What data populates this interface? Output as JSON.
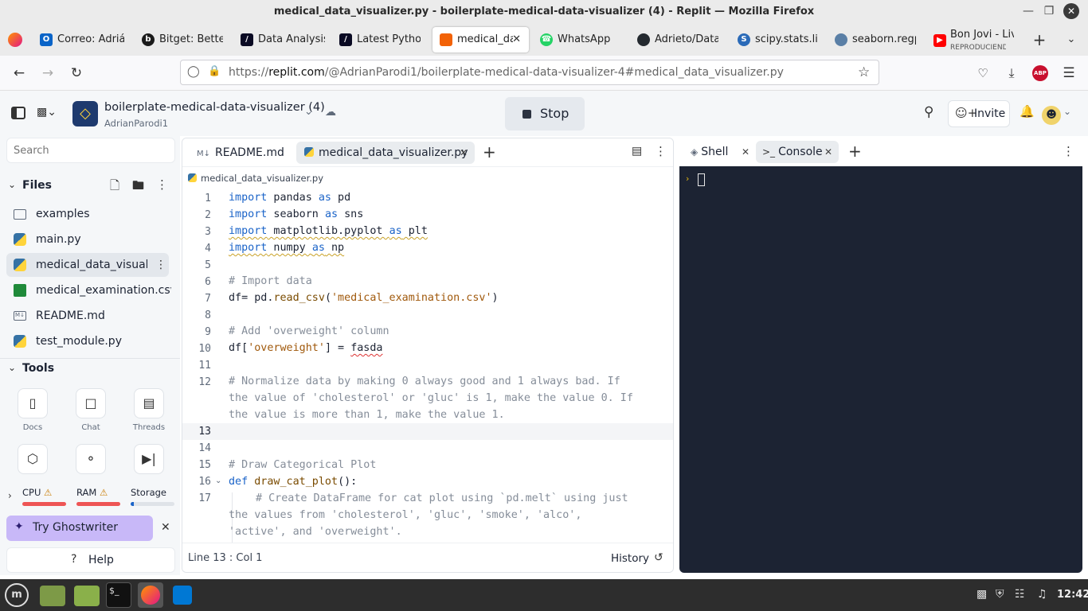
{
  "window": {
    "title": "medical_data_visualizer.py - boilerplate-medical-data-visualizer (4) - Replit — Mozilla Firefox"
  },
  "browser_tabs": [
    {
      "label": "Correo: Adriá",
      "icon": "outlook-icon"
    },
    {
      "label": "Bitget: Better",
      "icon": "bitget-icon"
    },
    {
      "label": "Data Analysis",
      "icon": "fcc-icon"
    },
    {
      "label": "Latest Python",
      "icon": "fcc-icon"
    },
    {
      "label": "medical_da",
      "icon": "replit-icon",
      "active": true
    },
    {
      "label": "WhatsApp",
      "icon": "whatsapp-icon"
    },
    {
      "label": "Adrieto/Data",
      "icon": "github-icon"
    },
    {
      "label": "scipy.stats.lin",
      "icon": "scipy-icon"
    },
    {
      "label": "seaborn.regp",
      "icon": "seaborn-icon"
    },
    {
      "label": "Bon Jovi - Liv",
      "sub": "REPRODUCIENDO",
      "icon": "youtube-icon"
    }
  ],
  "url": {
    "prefix": "https://",
    "domain": "replit.com",
    "path": "/@AdrianParodi1/boilerplate-medical-data-visualizer-4#medical_data_visualizer.py"
  },
  "ext": {
    "abp": "ABP"
  },
  "repl": {
    "name": "boilerplate-medical-data-visualizer (4)",
    "owner": "AdrianParodi1",
    "stop_label": "Stop",
    "invite_label": "Invite"
  },
  "sidebar": {
    "search_placeholder": "Search",
    "files_title": "Files",
    "files": [
      {
        "name": "examples",
        "type": "folder"
      },
      {
        "name": "main.py",
        "type": "python"
      },
      {
        "name": "medical_data_visual...",
        "type": "python",
        "active": true
      },
      {
        "name": "medical_examination.csv",
        "type": "csv"
      },
      {
        "name": "README.md",
        "type": "markdown"
      },
      {
        "name": "test_module.py",
        "type": "python"
      }
    ],
    "tools_title": "Tools",
    "tools": [
      {
        "label": "Docs",
        "icon": "book-icon"
      },
      {
        "label": "Chat",
        "icon": "chat-icon"
      },
      {
        "label": "Threads",
        "icon": "inbox-icon"
      },
      {
        "label": "",
        "icon": "cube-icon"
      },
      {
        "label": "",
        "icon": "git-icon"
      },
      {
        "label": "",
        "icon": "skip-icon"
      }
    ],
    "resources": {
      "cpu": "CPU",
      "ram": "RAM",
      "storage": "Storage",
      "cpu_level": 1.0,
      "ram_level": 1.0,
      "storage_level": 0.08
    },
    "ghostwriter_label": "Try Ghostwriter",
    "help_label": "Help"
  },
  "editor": {
    "tabs": [
      {
        "label": "README.md"
      },
      {
        "label": "medical_data_visualizer.py",
        "active": true
      }
    ],
    "breadcrumb": "medical_data_visualizer.py",
    "status": "Line 13 : Col 1",
    "history_label": "History",
    "line_numbers": [
      "1",
      "2",
      "3",
      "4",
      "5",
      "6",
      "7",
      "8",
      "9",
      "10",
      "11",
      "12",
      "13",
      "14",
      "15",
      "16",
      "17"
    ],
    "code": {
      "l1": [
        "import",
        " pandas ",
        "as",
        " pd"
      ],
      "l2": [
        "import",
        " seaborn ",
        "as",
        " sns"
      ],
      "l3": [
        "import",
        " matplotlib.pyplot ",
        "as",
        " plt"
      ],
      "l4": [
        "import",
        " numpy ",
        "as",
        " np"
      ],
      "l6": "# Import data",
      "l7": [
        "df= pd.",
        "read_csv",
        "(",
        "'medical_examination.csv'",
        ")"
      ],
      "l9": "# Add 'overweight' column",
      "l10": [
        "df[",
        "'overweight'",
        "] = ",
        "fasda"
      ],
      "l12a": "# Normalize data by making 0 always good and 1 always bad. If",
      "l12b": "the value of 'cholesterol' or 'gluc' is 1, make the value 0. If",
      "l12c": "the value is more than 1, make the value 1.",
      "l15": "# Draw Categorical Plot",
      "l16": [
        "def",
        " ",
        "draw_cat_plot",
        "():"
      ],
      "l17a": "# Create DataFrame for cat plot using `pd.melt` using just",
      "l17b": "the values from 'cholesterol', 'gluc', 'smoke', 'alco',",
      "l17c": "'active', and 'overweight'."
    }
  },
  "shell": {
    "tabs": [
      {
        "label": "Shell",
        "icon": "shell-icon"
      },
      {
        "label": "Console",
        "icon": "console-icon",
        "active": true
      }
    ]
  },
  "taskbar": {
    "clock": "12:42"
  }
}
